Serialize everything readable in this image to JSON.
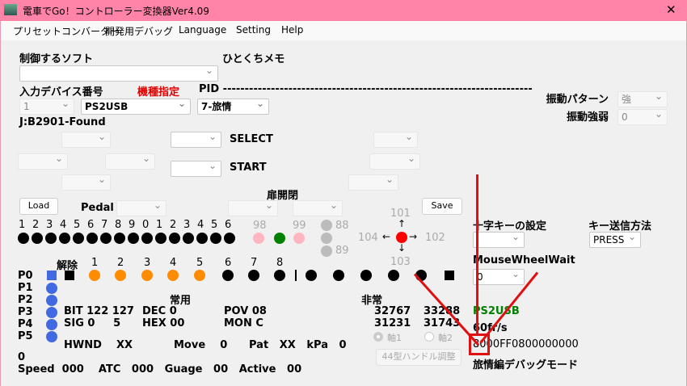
{
  "window": {
    "title": "電車でGo！コントローラー変換器Ver4.09",
    "close": "✕"
  },
  "menu": [
    "プリセットコンバーター",
    "開発用デバッグ",
    "Language",
    "Setting",
    "Help"
  ],
  "labels": {
    "soft": "制御するソフト",
    "memo": "ひとくちメモ",
    "device_no": "入力デバイス番号",
    "model": "機種指定",
    "pid": "PID -----------------------------------------------------------------------",
    "found": "J:B2901-Found",
    "select": "SELECT",
    "start": "START",
    "vib_pattern": "振動パターン",
    "vib_strength": "振動強弱",
    "pedal": "Pedal",
    "door": "扉開閉",
    "cross_key": "十字キーの設定",
    "key_send": "キー送信方法",
    "mouse_wheel": "MouseWheelWait",
    "release": "解除",
    "normal": "常用",
    "emergency": "非常"
  },
  "combos": {
    "soft": "",
    "device": "1",
    "model": "PS2USB",
    "pid": "7-旅情",
    "vib_pattern": "強",
    "vib_strength": "0",
    "key_send": "PRESS",
    "mouse_wheel": "0",
    "cross_key": ""
  },
  "buttons": {
    "load": "Load",
    "save": "Save",
    "handle_adjust": "44型ハンドル調整"
  },
  "button_numbers": [
    "1",
    "2",
    "3",
    "4",
    "5",
    "6",
    "7",
    "8",
    "9",
    "0",
    "1",
    "2",
    "3",
    "4",
    "5",
    "6"
  ],
  "extra": {
    "n98": "98",
    "n99": "99",
    "n88": "88",
    "n89": "89",
    "up": "101",
    "right": "102",
    "down": "103",
    "left": "104"
  },
  "notch_labels": [
    "1",
    "2",
    "3",
    "4",
    "5",
    "6",
    "7",
    "8"
  ],
  "ports": [
    "P0",
    "P1",
    "P2",
    "P3",
    "P4",
    "P5"
  ],
  "stats": {
    "bit": "BIT 122 127",
    "dec": "DEC  0",
    "pov": "POV  08",
    "sig": "SIG 0     5",
    "hex": "HEX  00",
    "mon": "MON  C",
    "e1": "32767",
    "e2": "33288",
    "e3": "31231",
    "e4": "31743",
    "axis1": "軸1",
    "axis2": "軸2",
    "hwnd": "HWND    XX",
    "move": "Move    0",
    "pat": "Pat   XX   kPa   0",
    "zero": "0",
    "speed": "Speed  000    ATC   000   Guage   00   Active   00"
  },
  "status": {
    "device": "PS2USB",
    "fps": "60fr/s",
    "hex": "8000FF0800000000",
    "mode": "旅情編デバッグモード"
  },
  "colors": {
    "titlebar": "#ff84a8",
    "orange": "#ff8c00",
    "blue": "#4169e1",
    "green": "#008000",
    "pink": "#ffb6c1",
    "red": "#ff0000",
    "annotation": "#e01010"
  }
}
